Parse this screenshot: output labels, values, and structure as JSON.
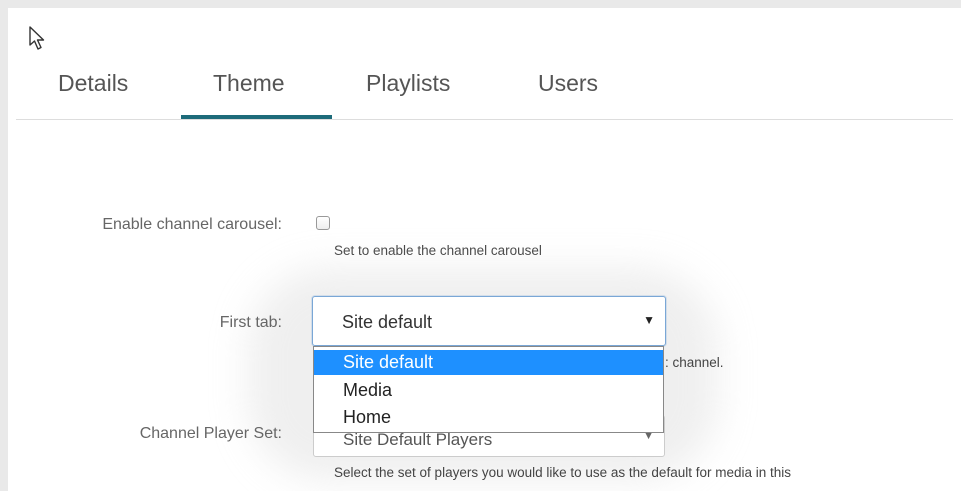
{
  "tabs": [
    {
      "label": "Details"
    },
    {
      "label": "Theme",
      "active": true
    },
    {
      "label": "Playlists"
    },
    {
      "label": "Users"
    }
  ],
  "form": {
    "carousel": {
      "label": "Enable channel carousel:",
      "checked": false,
      "help": "Set to enable the channel carousel"
    },
    "first_tab": {
      "label": "First tab:",
      "selected": "Site default",
      "help_fragment": ": channel.",
      "options": [
        "Site default",
        "Media",
        "Home"
      ]
    },
    "player_set": {
      "label": "Channel Player Set:",
      "selected": "Site Default Players",
      "help": "Select the set of players you would like to use as the default for media in this"
    }
  },
  "colors": {
    "active_tab_underline": "#1d6b7a",
    "dropdown_highlight": "#1e90ff"
  },
  "icons": {
    "cursor": "mouse-pointer-icon",
    "select_arrow": "triangle-down-icon",
    "checkbox": "checkbox-icon"
  }
}
